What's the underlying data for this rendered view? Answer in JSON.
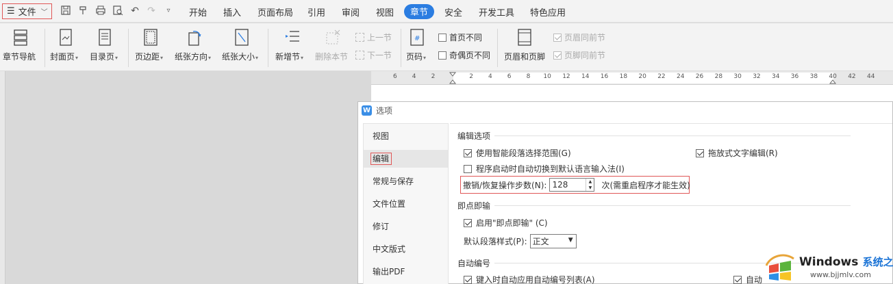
{
  "menubar": {
    "file_label": "文件",
    "tabs": [
      "开始",
      "插入",
      "页面布局",
      "引用",
      "审阅",
      "视图",
      "章节",
      "安全",
      "开发工具",
      "特色应用"
    ],
    "active_tab": "章节"
  },
  "ribbon": {
    "section_nav": "章节导航",
    "cover_page": "封面页",
    "toc_page": "目录页",
    "margins": "页边距",
    "orientation": "纸张方向",
    "paper_size": "纸张大小",
    "new_section": "新增节",
    "delete_section": "删除本节",
    "prev_section": "上一节",
    "next_section": "下一节",
    "page_number": "页码",
    "first_page_diff": "首页不同",
    "odd_even_diff": "奇偶页不同",
    "header_footer": "页眉和页脚",
    "header_same_prev": "页眉同前节",
    "footer_same_prev": "页脚同前节"
  },
  "ruler": {
    "ticks": [
      "6",
      "4",
      "2",
      "",
      "2",
      "4",
      "6",
      "8",
      "10",
      "12",
      "14",
      "16",
      "18",
      "20",
      "22",
      "24",
      "26",
      "28",
      "30",
      "32",
      "34",
      "36",
      "38",
      "40",
      "42",
      "44"
    ]
  },
  "dialog": {
    "title": "选项",
    "sidebar": [
      "视图",
      "编辑",
      "常规与保存",
      "文件位置",
      "修订",
      "中文版式",
      "输出PDF"
    ],
    "active_item": "编辑",
    "edit_section_title": "编辑选项",
    "smart_paragraph": "使用智能段落选择范围(G)",
    "drag_drop": "拖放式文字编辑(R)",
    "auto_switch_ime": "程序启动时自动切换到默认语言输入法(I)",
    "undo_steps_label": "撤销/恢复操作步数(N):",
    "undo_steps_value": "128",
    "undo_steps_note": "次(需重启程序才能生效)",
    "click_type_title": "即点即输",
    "enable_click_type": "启用\"即点即输\" (C)",
    "default_para_style_label": "默认段落样式(P):",
    "default_para_style_value": "正文",
    "auto_number_title": "自动编号",
    "auto_number_list": "键入时自动应用自动编号列表(A)",
    "auto_partial": "自动"
  },
  "watermark": {
    "brand": "Windows",
    "brand_cn": "系统之家",
    "url": "www.bjjmlv.com"
  }
}
